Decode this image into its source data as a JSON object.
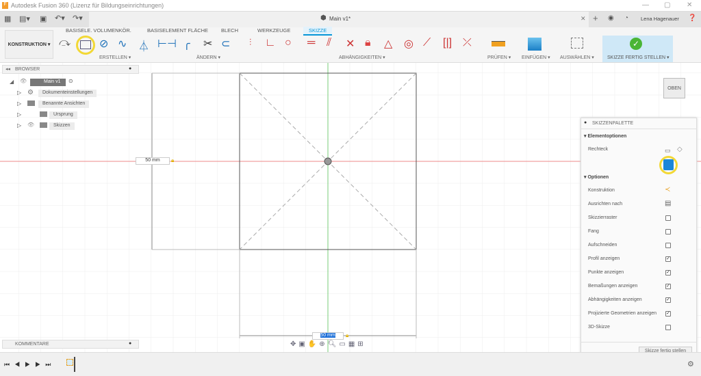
{
  "window": {
    "title": "Autodesk Fusion 360 (Lizenz für Bildungseinrichtungen)",
    "doc_tab": "Main v1*",
    "user": "Lena Hagenauer"
  },
  "toolbar": {
    "workspace": "KONSTRUKTION ▾",
    "tabs": [
      "BASISELE. VOLUMENKÖR.",
      "BASISELEMENT FLÄCHE",
      "BLECH",
      "WERKZEUGE",
      "SKIZZE"
    ],
    "active_tab": "SKIZZE",
    "groups": {
      "create": "ERSTELLEN ▾",
      "modify": "ÄNDERN ▾",
      "constraints": "ABHÄNGIGKEITEN ▾",
      "inspect": "PRÜFEN ▾",
      "insert": "EINFÜGEN ▾",
      "select": "AUSWÄHLEN ▾",
      "finish": "SKIZZE FERTIG STELLEN ▾"
    }
  },
  "browser": {
    "title": "BROWSER",
    "items": [
      {
        "label": "Main v1"
      },
      {
        "label": "Dokumenteinstellungen"
      },
      {
        "label": "Benannte Ansichten"
      },
      {
        "label": "Ursprung"
      },
      {
        "label": "Skizzen"
      }
    ]
  },
  "comments": {
    "title": "KOMMENTARE"
  },
  "sketch": {
    "dim_vertical": "50 mm",
    "dim_horizontal": "50 mm"
  },
  "viewcube": {
    "label": "OBEN"
  },
  "palette": {
    "title": "SKIZZENPALETTE",
    "section1": "Elementoptionen",
    "rect_label": "Rechteck",
    "section2": "Optionen",
    "options": [
      {
        "label": "Konstruktion",
        "type": "icon"
      },
      {
        "label": "Ausrichten nach",
        "type": "icon"
      },
      {
        "label": "Skizzierraster",
        "checked": false
      },
      {
        "label": "Fang",
        "checked": false
      },
      {
        "label": "Aufschneiden",
        "checked": false
      },
      {
        "label": "Profil anzeigen",
        "checked": true
      },
      {
        "label": "Punkte anzeigen",
        "checked": true
      },
      {
        "label": "Bemaßungen anzeigen",
        "checked": true
      },
      {
        "label": "Abhängigkeiten anzeigen",
        "checked": true
      },
      {
        "label": "Projizierte Geometrien anzeigen",
        "checked": true
      },
      {
        "label": "3D-Skizze",
        "checked": false
      }
    ],
    "finish_button": "Skizze fertig stellen"
  },
  "colors": {
    "accent": "#0696d7",
    "finish_bg": "#cfe8f7",
    "highlight": "#f2d836",
    "axis_x": "#e88",
    "axis_y": "#7c7"
  }
}
